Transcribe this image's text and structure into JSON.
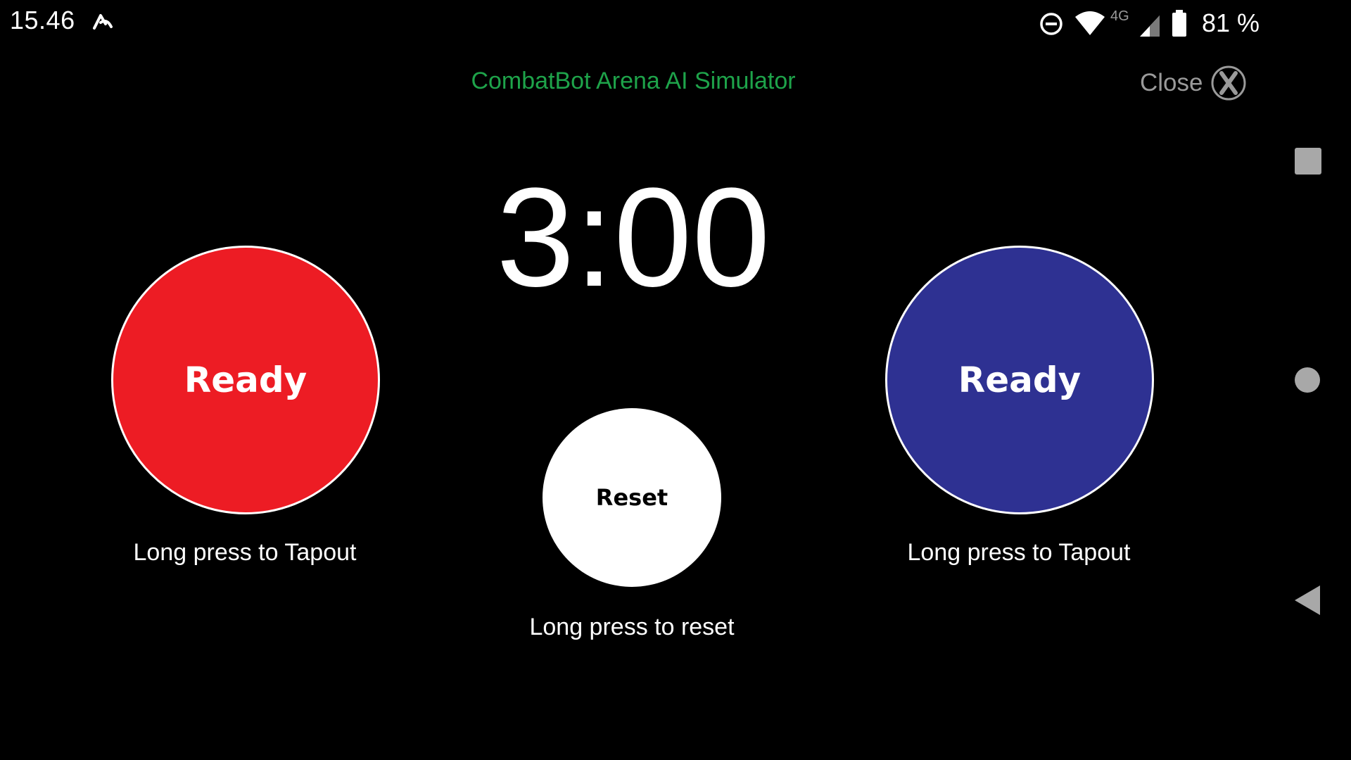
{
  "status_bar": {
    "time": "15.46",
    "network": "4G",
    "battery": "81 %",
    "icons": [
      "app-notification-icon",
      "do-not-disturb-icon",
      "wifi-icon",
      "signal-icon",
      "battery-icon"
    ]
  },
  "header": {
    "title": "CombatBot Arena AI Simulator",
    "close_label": "Close",
    "close_icon": "x-circle-icon"
  },
  "timer": {
    "value": "3:00"
  },
  "red_corner": {
    "label": "Ready",
    "hint": "Long press to Tapout",
    "color": "#ed1c24"
  },
  "blue_corner": {
    "label": "Ready",
    "hint": "Long press to Tapout",
    "color": "#2e3192"
  },
  "reset": {
    "label": "Reset",
    "hint": "Long press to reset"
  },
  "nav_bar": {
    "buttons": [
      "recents-icon",
      "home-icon",
      "back-icon"
    ]
  },
  "colors": {
    "background": "#000000",
    "title_green": "#1ea34a",
    "muted_gray": "#9a9a9a"
  }
}
